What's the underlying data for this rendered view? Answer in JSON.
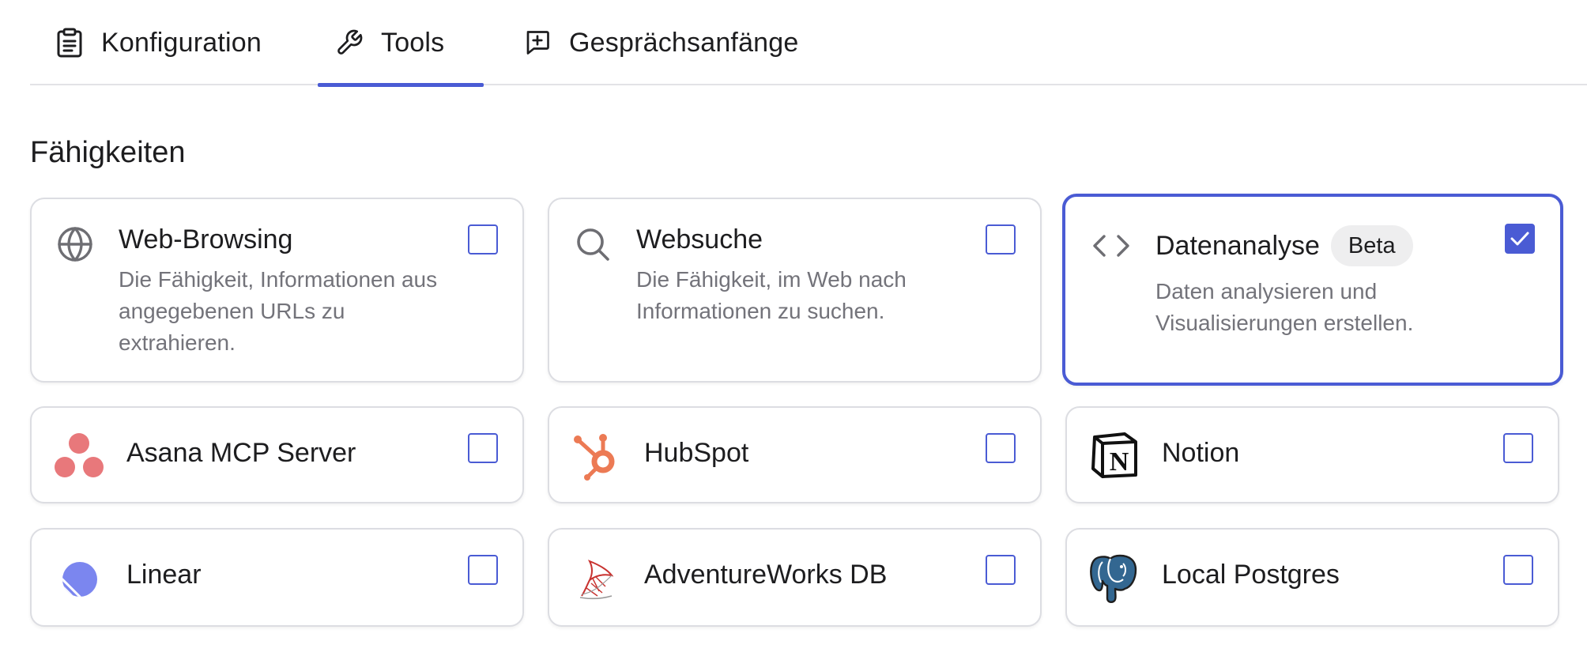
{
  "tabs": [
    {
      "label": "Konfiguration",
      "icon": "clipboard-icon",
      "active": false
    },
    {
      "label": "Tools",
      "icon": "wrench-icon",
      "active": true
    },
    {
      "label": "Gesprächsanfänge",
      "icon": "chat-plus-icon",
      "active": false
    }
  ],
  "section": {
    "title": "Fähigkeiten"
  },
  "accent_color": "#4a5bd4",
  "capabilities": [
    {
      "title": "Web-Browsing",
      "description": "Die Fähigkeit, Informationen aus angegebenen URLs zu extrahieren.",
      "icon": "globe-icon",
      "checked": false
    },
    {
      "title": "Websuche",
      "description": "Die Fähigkeit, im Web nach Informationen zu suchen.",
      "icon": "search-icon",
      "checked": false
    },
    {
      "title": "Datenanalyse",
      "badge": "Beta",
      "description": "Daten analysieren und Visualisierungen erstellen.",
      "icon": "code-icon",
      "checked": true
    }
  ],
  "integrations": [
    {
      "title": "Asana MCP Server",
      "icon": "asana-logo-icon",
      "checked": false
    },
    {
      "title": "HubSpot",
      "icon": "hubspot-logo-icon",
      "checked": false
    },
    {
      "title": "Notion",
      "icon": "notion-logo-icon",
      "checked": false
    },
    {
      "title": "Linear",
      "icon": "linear-logo-icon",
      "checked": false
    },
    {
      "title": "AdventureWorks DB",
      "icon": "sql-server-logo-icon",
      "checked": false
    },
    {
      "title": "Local Postgres",
      "icon": "postgres-elephant-icon",
      "checked": false
    }
  ]
}
